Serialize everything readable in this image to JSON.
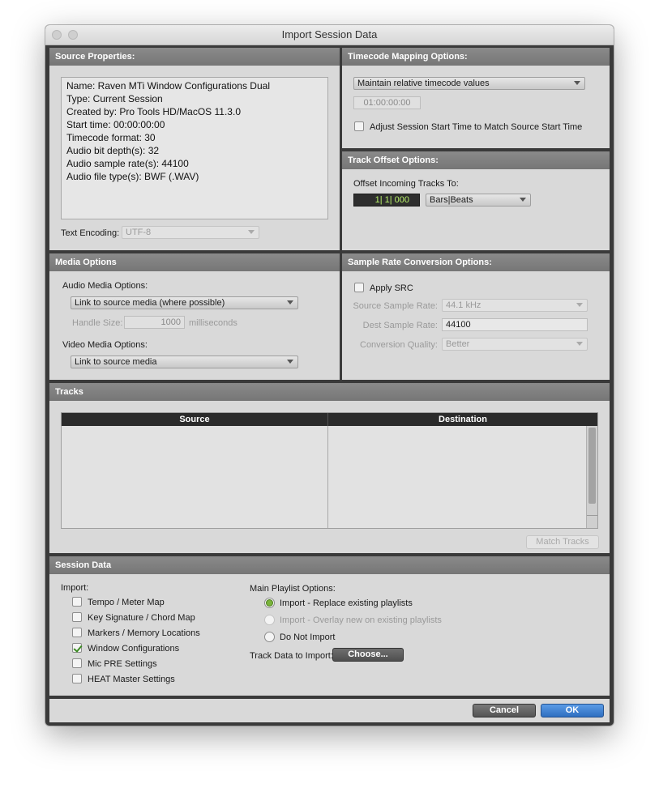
{
  "window": {
    "title": "Import Session Data"
  },
  "source_properties": {
    "header": "Source Properties:",
    "lines": [
      "Name: Raven MTi Window Configurations Dual",
      "Type: Current Session",
      "Created by: Pro Tools HD/MacOS 11.3.0",
      "Start time: 00:00:00:00",
      "Timecode format: 30",
      "Audio bit depth(s): 32",
      "Audio sample rate(s): 44100",
      "Audio file type(s): BWF (.WAV)"
    ],
    "text_encoding_label": "Text Encoding:",
    "text_encoding_value": "UTF-8"
  },
  "timecode_mapping": {
    "header": "Timecode Mapping Options:",
    "mode": "Maintain relative timecode values",
    "timecode_value": "01:00:00:00",
    "adjust_label": "Adjust Session Start Time to Match Source Start Time"
  },
  "track_offset": {
    "header": "Track Offset Options:",
    "label": "Offset Incoming Tracks To:",
    "value": "1| 1| 000",
    "unit": "Bars|Beats"
  },
  "media_options": {
    "header": "Media Options",
    "audio_label": "Audio Media Options:",
    "audio_value": "Link to source media (where possible)",
    "handle_label": "Handle Size:",
    "handle_value": "1000",
    "handle_unit": "milliseconds",
    "video_label": "Video Media Options:",
    "video_value": "Link to source media"
  },
  "src": {
    "header": "Sample Rate Conversion Options:",
    "apply_label": "Apply SRC",
    "source_rate_label": "Source Sample Rate:",
    "source_rate_value": "44.1 kHz",
    "dest_rate_label": "Dest Sample Rate:",
    "dest_rate_value": "44100",
    "quality_label": "Conversion Quality:",
    "quality_value": "Better"
  },
  "tracks": {
    "header": "Tracks",
    "col_source": "Source",
    "col_destination": "Destination",
    "match_button": "Match Tracks"
  },
  "session_data": {
    "header": "Session Data",
    "import_label": "Import:",
    "import_items": [
      {
        "label": "Tempo / Meter Map",
        "checked": false
      },
      {
        "label": "Key Signature / Chord Map",
        "checked": false
      },
      {
        "label": "Markers / Memory Locations",
        "checked": false
      },
      {
        "label": "Window Configurations",
        "checked": true
      },
      {
        "label": "Mic PRE Settings",
        "checked": false
      },
      {
        "label": "HEAT Master Settings",
        "checked": false
      }
    ],
    "playlist_label": "Main Playlist Options:",
    "playlist_options": [
      {
        "label": "Import - Replace existing playlists",
        "selected": true
      },
      {
        "label": "Import - Overlay new on existing playlists",
        "selected": false
      },
      {
        "label": "Do Not Import",
        "selected": false
      }
    ],
    "track_data_label": "Track Data to Import:",
    "choose_button": "Choose..."
  },
  "footer": {
    "cancel": "Cancel",
    "ok": "OK"
  },
  "colors": {
    "ok_blue": "#3b7fd1",
    "offset_green": "#b8f26a",
    "check_green": "#3b8a22"
  }
}
